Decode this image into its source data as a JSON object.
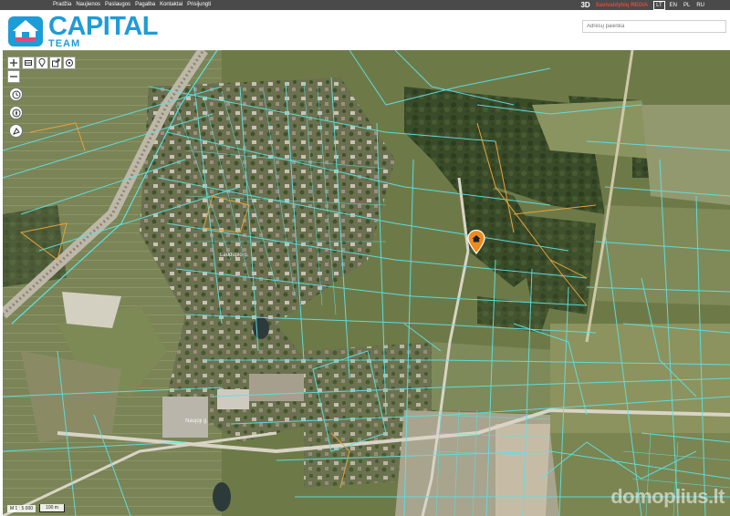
{
  "nav": {
    "items": [
      "Pradžia",
      "Naujienos",
      "Paslaugos",
      "Pagalba",
      "Kontaktai",
      "Prisijungti"
    ]
  },
  "topbar": {
    "mode_3d": "3D",
    "municipal": "Savivaldybių REGIA",
    "languages": [
      "LT",
      "EN",
      "PL",
      "RU"
    ],
    "active_language": "LT"
  },
  "brand": {
    "name": "CAPITAL",
    "sub": "TEAM",
    "color": "#1e9cd7",
    "house_color": "#1e9cd7",
    "accent": "#e04a7a"
  },
  "search": {
    "placeholder": "Adresų paieška"
  },
  "map": {
    "scale_ratio": "M 1 : 5 000",
    "scale_bar": "100 m",
    "watermark": "domoplius.lt",
    "parcel_color": "#5fe0e0",
    "marker_color": "#f08a1c",
    "labels": [
      "Laudupio g.",
      "Naujoji g."
    ],
    "controls": [
      "zoom-in",
      "zoom-out",
      "layers",
      "location",
      "share",
      "target",
      "clock",
      "compass",
      "measure"
    ]
  }
}
